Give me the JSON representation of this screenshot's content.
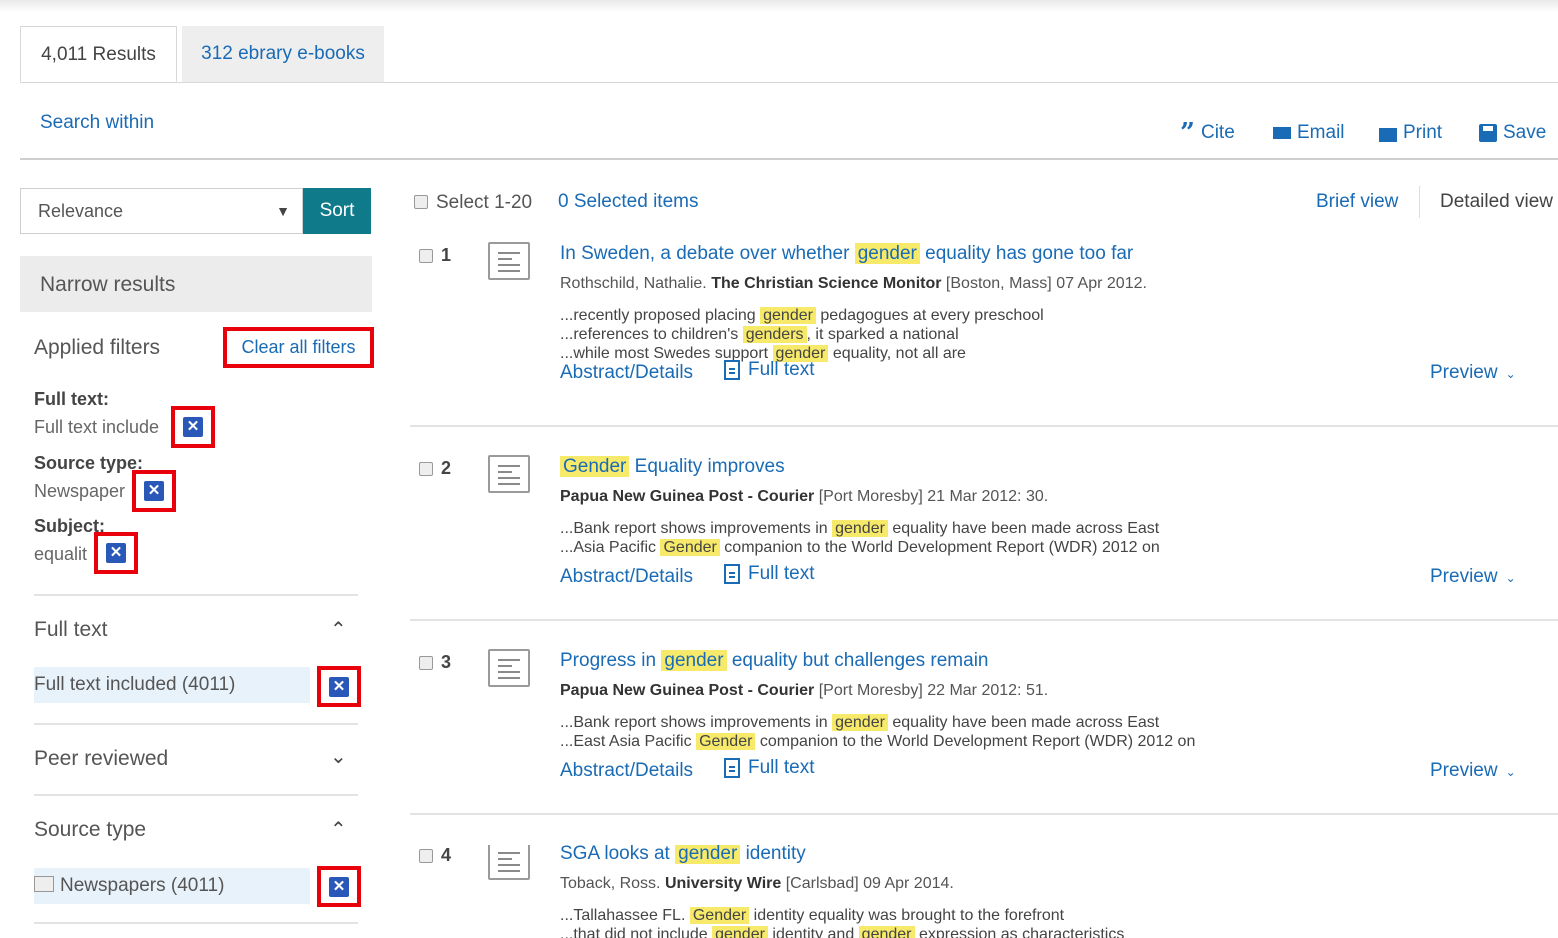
{
  "tabs": [
    {
      "label": "4,011 Results"
    },
    {
      "label": "312 ebrary e-books"
    }
  ],
  "search_within": "Search within",
  "tools": {
    "cite": "Cite",
    "email": "Email",
    "print": "Print",
    "save": "Save"
  },
  "sort": {
    "selected": "Relevance",
    "button": "Sort"
  },
  "narrow": {
    "title": "Narrow results",
    "applied_label": "Applied filters",
    "clear_all": "Clear all filters",
    "applied": [
      {
        "label": "Full text:",
        "value": "Full text include"
      },
      {
        "label": "Source type:",
        "value": "Newspaper"
      },
      {
        "label": "Subject:",
        "value": "equalit"
      }
    ],
    "sections": [
      {
        "title": "Full text",
        "option": "Full text included (4011)"
      },
      {
        "title": "Peer reviewed"
      },
      {
        "title": "Source type",
        "option": "Newspapers (4011)"
      }
    ]
  },
  "results_header": {
    "select_all": "Select 1-20",
    "selected_items": "0 Selected items",
    "brief_view": "Brief view",
    "detailed_view": "Detailed view"
  },
  "result_links": {
    "abstract": "Abstract/Details",
    "full_text": "Full text",
    "preview": "Preview"
  },
  "results": [
    {
      "num": "1",
      "title_pre": "In Sweden, a debate over whether ",
      "title_hl": "gender",
      "title_post": " equality has gone too far",
      "author": "Rothschild, Nathalie.",
      "source": "The Christian Science Monitor",
      "rest": "[Boston, Mass] 07 Apr 2012.",
      "snippets": [
        {
          "pre": "...recently proposed placing ",
          "hl": "gender",
          "post": " pedagogues at every preschool"
        },
        {
          "pre": "...references to children's ",
          "hl": "genders",
          "post": ", it sparked a national"
        },
        {
          "pre": "...while most Swedes support ",
          "hl": "gender",
          "post": " equality, not all are"
        }
      ]
    },
    {
      "num": "2",
      "title_pre": "",
      "title_hl": "Gender",
      "title_post": " Equality improves",
      "author": "",
      "source": "Papua New Guinea Post - Courier",
      "rest": "[Port Moresby] 21 Mar 2012: 30.",
      "snippets": [
        {
          "pre": "...Bank report shows improvements in ",
          "hl": "gender",
          "post": " equality have been made across East"
        },
        {
          "pre": "...Asia Pacific ",
          "hl": "Gender",
          "post": " companion to the World Development Report (WDR) 2012 on"
        }
      ]
    },
    {
      "num": "3",
      "title_pre": "Progress in ",
      "title_hl": "gender",
      "title_post": " equality but challenges remain",
      "author": "",
      "source": "Papua New Guinea Post - Courier",
      "rest": "[Port Moresby] 22 Mar 2012: 51.",
      "snippets": [
        {
          "pre": "...Bank report shows improvements in ",
          "hl": "gender",
          "post": " equality have been made across East"
        },
        {
          "pre": "...East Asia Pacific ",
          "hl": "Gender",
          "post": " companion to the World Development Report (WDR) 2012 on"
        }
      ]
    },
    {
      "num": "4",
      "title_pre": "SGA looks at ",
      "title_hl": "gender",
      "title_post": " identity",
      "author": "Toback, Ross.",
      "source": "University Wire",
      "rest": "[Carlsbad] 09 Apr 2014.",
      "snippets": [
        {
          "pre": "...Tallahassee FL. ",
          "hl": "Gender",
          "post": " identity equality was brought to the forefront"
        },
        {
          "pre": "...that did not include ",
          "hl": "gender",
          "post": " identity and ",
          "hl2": "gender",
          "post2": " expression as characteristics"
        }
      ]
    }
  ],
  "colors": {
    "link": "#1a6bb5",
    "sort_button": "#0f7b8a",
    "highlight": "#f7ea6b",
    "remove_icon": "#2a58b8",
    "annotation_box": "#e8000b"
  }
}
